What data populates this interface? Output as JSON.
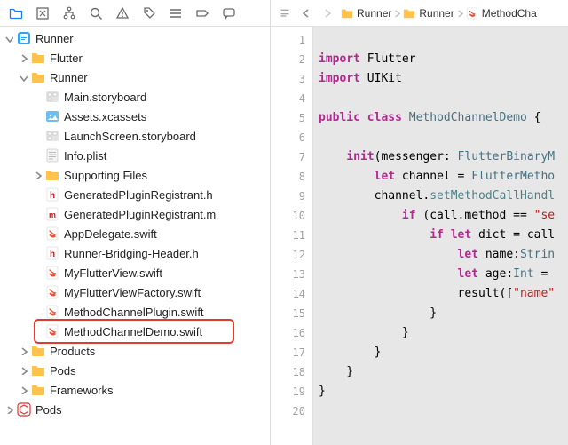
{
  "toolbar": {
    "icons": [
      "folder",
      "box",
      "hierarchy",
      "search",
      "warning",
      "tag",
      "list",
      "label",
      "comment"
    ]
  },
  "tree": {
    "items": [
      {
        "indent": 0,
        "disclosure": "down",
        "icon": "xcode",
        "label": "Runner"
      },
      {
        "indent": 1,
        "disclosure": "right",
        "icon": "folder",
        "label": "Flutter"
      },
      {
        "indent": 1,
        "disclosure": "down",
        "icon": "folder",
        "label": "Runner"
      },
      {
        "indent": 2,
        "disclosure": "none",
        "icon": "storyboard",
        "label": "Main.storyboard"
      },
      {
        "indent": 2,
        "disclosure": "none",
        "icon": "assets",
        "label": "Assets.xcassets"
      },
      {
        "indent": 2,
        "disclosure": "none",
        "icon": "storyboard",
        "label": "LaunchScreen.storyboard"
      },
      {
        "indent": 2,
        "disclosure": "none",
        "icon": "plist",
        "label": "Info.plist"
      },
      {
        "indent": 2,
        "disclosure": "right",
        "icon": "folder",
        "label": "Supporting Files"
      },
      {
        "indent": 2,
        "disclosure": "none",
        "icon": "header",
        "label": "GeneratedPluginRegistrant.h"
      },
      {
        "indent": 2,
        "disclosure": "none",
        "icon": "impl",
        "label": "GeneratedPluginRegistrant.m"
      },
      {
        "indent": 2,
        "disclosure": "none",
        "icon": "swift",
        "label": "AppDelegate.swift"
      },
      {
        "indent": 2,
        "disclosure": "none",
        "icon": "header",
        "label": "Runner-Bridging-Header.h"
      },
      {
        "indent": 2,
        "disclosure": "none",
        "icon": "swift",
        "label": "MyFlutterView.swift"
      },
      {
        "indent": 2,
        "disclosure": "none",
        "icon": "swift",
        "label": "MyFlutterViewFactory.swift"
      },
      {
        "indent": 2,
        "disclosure": "none",
        "icon": "swift",
        "label": "MethodChannelPlugin.swift"
      },
      {
        "indent": 2,
        "disclosure": "none",
        "icon": "swift",
        "label": "MethodChannelDemo.swift",
        "highlighted": true
      },
      {
        "indent": 1,
        "disclosure": "right",
        "icon": "folder",
        "label": "Products"
      },
      {
        "indent": 1,
        "disclosure": "right",
        "icon": "folder",
        "label": "Pods"
      },
      {
        "indent": 1,
        "disclosure": "right",
        "icon": "folder",
        "label": "Frameworks"
      },
      {
        "indent": 0,
        "disclosure": "right",
        "icon": "pods",
        "label": "Pods"
      }
    ]
  },
  "breadcrumbs": [
    {
      "icon": "folder",
      "label": "Runner"
    },
    {
      "icon": "folder",
      "label": "Runner"
    },
    {
      "icon": "swift",
      "label": "MethodCha"
    }
  ],
  "code": {
    "lines": [
      {
        "n": 1,
        "html": ""
      },
      {
        "n": 2,
        "html": "<span class='kw'>import</span> <span class='ident'>Flutter</span>"
      },
      {
        "n": 3,
        "html": "<span class='kw'>import</span> <span class='ident'>UIKit</span>"
      },
      {
        "n": 4,
        "html": ""
      },
      {
        "n": 5,
        "html": "<span class='kw'>public</span> <span class='kw'>class</span> <span class='type'>MethodChannelDemo</span> {"
      },
      {
        "n": 6,
        "html": ""
      },
      {
        "n": 7,
        "html": "    <span class='kw'>init</span>(messenger: <span class='type'>FlutterBinaryM</span>"
      },
      {
        "n": 8,
        "html": "        <span class='kw'>let</span> channel = <span class='type'>FlutterMetho</span>"
      },
      {
        "n": 9,
        "html": "        channel.<span class='method'>setMethodCallHandl</span>"
      },
      {
        "n": 10,
        "html": "            <span class='kw'>if</span> (call.method == <span class='str'>\"se</span>"
      },
      {
        "n": 11,
        "html": "                <span class='kw'>if</span> <span class='kw'>let</span> dict = call"
      },
      {
        "n": 12,
        "html": "                    <span class='kw'>let</span> name:<span class='type'>Strin</span>"
      },
      {
        "n": 13,
        "html": "                    <span class='kw'>let</span> age:<span class='type'>Int</span> = "
      },
      {
        "n": 14,
        "html": "                    result([<span class='str'>\"name\"</span>"
      },
      {
        "n": 15,
        "html": "                }"
      },
      {
        "n": 16,
        "html": "            }"
      },
      {
        "n": 17,
        "html": "        }"
      },
      {
        "n": 18,
        "html": "    }"
      },
      {
        "n": 19,
        "html": "}"
      },
      {
        "n": 20,
        "html": ""
      }
    ]
  }
}
